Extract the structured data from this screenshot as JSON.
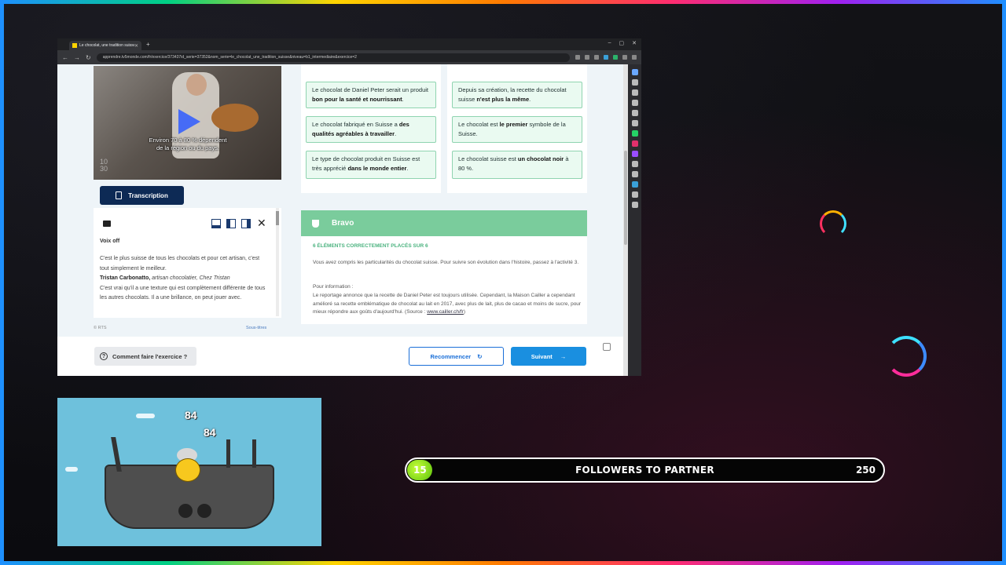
{
  "browser": {
    "tab_title": "Le chocolat, une tradition suisse",
    "url": "apprendre.tv5monde.com/fr/exercice/373437id_serie=37352&nom_serie=le_chocolat_une_tradition_suisse&niveau=b1_intermediaire&exercice=2"
  },
  "video": {
    "subtitle_line1": "Environ 70 à 80 % dépendent",
    "subtitle_line2": "de la région ou du pays.",
    "timecode": "10\n30",
    "transcription_label": "Transcription"
  },
  "transcript": {
    "speaker_off": "Voix off",
    "line1": "C'est le plus suisse de tous les chocolats et pour cet artisan, c'est tout simplement le meilleur.",
    "speaker_name": "Tristan Carbonatto,",
    "speaker_role": "artisan chocolatier, Chez Tristan",
    "line2": "C'est vrai qu'il a une texture qui est complètement différente de tous les autres chocolats. Il a une brillance, on peut jouer avec.",
    "credit": "© RTS",
    "subtitles_label": "Sous-titres"
  },
  "cards_left": [
    {
      "pre": "Le chocolat de Daniel Peter serait un produit ",
      "bold": "bon pour la santé et nourrissant",
      "post": "."
    },
    {
      "pre": "Le chocolat fabriqué en Suisse a ",
      "bold": "des qualités agréables à travailler",
      "post": "."
    },
    {
      "pre": "Le type de chocolat produit en Suisse est très apprécié ",
      "bold": "dans le monde entier",
      "post": "."
    }
  ],
  "cards_right": [
    {
      "pre": "Depuis sa création, la recette du chocolat suisse ",
      "bold": "n'est plus la même",
      "post": "."
    },
    {
      "pre": "Le chocolat est ",
      "bold": "le premier",
      "post": " symbole de la Suisse."
    },
    {
      "pre": "Le chocolat suisse est ",
      "bold": "un chocolat noir",
      "post": " à 80 %."
    }
  ],
  "result": {
    "title": "Bravo",
    "score": "6 ÉLÉMENTS CORRECTEMENT PLACÉS SUR 6",
    "message": "Vous avez compris les particularités du chocolat suisse. Pour suivre son évolution dans l'histoire, passez à l'activité 3.",
    "info_label": "Pour information :",
    "info": "Le reportage annonce que la recette de Daniel Peter est toujours utilisée. Cependant, la Maison Cailler a cependant amélioré sa recette emblématique de chocolat au lait en 2017, avec plus de lait, plus de cacao et moins de sucre, pour mieux répondre aux goûts d'aujourd'hui. (Source : ",
    "info_link": "www.cailler.ch/fr",
    "info_end": ")"
  },
  "bottom": {
    "help_label": "Comment faire l'exercice ?",
    "restart_label": "Recommencer",
    "next_label": "Suivant"
  },
  "game": {
    "score_top": "84",
    "score_mid": "84"
  },
  "followers": {
    "current": "15",
    "label": "FOLLOWERS TO PARTNER",
    "goal": "250",
    "progress_fraction": 0.06
  }
}
